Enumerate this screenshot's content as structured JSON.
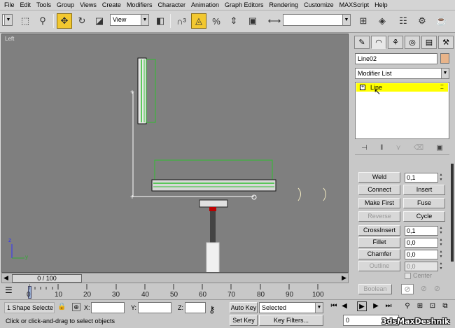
{
  "menu": [
    "File",
    "Edit",
    "Tools",
    "Group",
    "Views",
    "Create",
    "Modifiers",
    "Character",
    "Animation",
    "Graph Editors",
    "Rendering",
    "Customize",
    "MAXScript",
    "Help"
  ],
  "toolbar": {
    "refcoord": "View",
    "named_sel": ""
  },
  "viewport": {
    "label": "Left",
    "axis_z": "z",
    "axis_y": "y"
  },
  "command_panel": {
    "object_name": "Line02",
    "modifier_list": "Modifier List",
    "stack_item": "Line",
    "buttons": {
      "weld": "Weld",
      "weld_val": "0,1",
      "connect": "Connect",
      "insert": "Insert",
      "make_first": "Make First",
      "fuse": "Fuse",
      "reverse": "Reverse",
      "cycle": "Cycle",
      "crossinsert": "CrossInsert",
      "crossinsert_val": "0,1",
      "fillet": "Fillet",
      "fillet_val": "0,0",
      "chamfer": "Chamfer",
      "chamfer_val": "0,0",
      "outline": "Outline",
      "outline_val": "0,0",
      "center": "Center",
      "boolean": "Boolean"
    }
  },
  "timeline": {
    "slider": "0 / 100",
    "ticks": [
      "0",
      "10",
      "20",
      "30",
      "40",
      "50",
      "60",
      "70",
      "80",
      "90",
      "100"
    ]
  },
  "status": {
    "selection": "1 Shape Selecte",
    "x_label": "X:",
    "y_label": "Y:",
    "z_label": "Z:",
    "auto_key": "Auto Key",
    "set_key": "Set Key",
    "selected": "Selected",
    "key_filters": "Key Filters...",
    "frame": "0",
    "prompt": "Click or click-and-drag to select objects"
  },
  "watermark": "3dsMaxDeshnik",
  "colors": {
    "viewport_bg": "#7f7f7f",
    "selected_item": "#ffff00",
    "active_tool": "#f2c830",
    "shape_green": "#2fbf2f"
  }
}
